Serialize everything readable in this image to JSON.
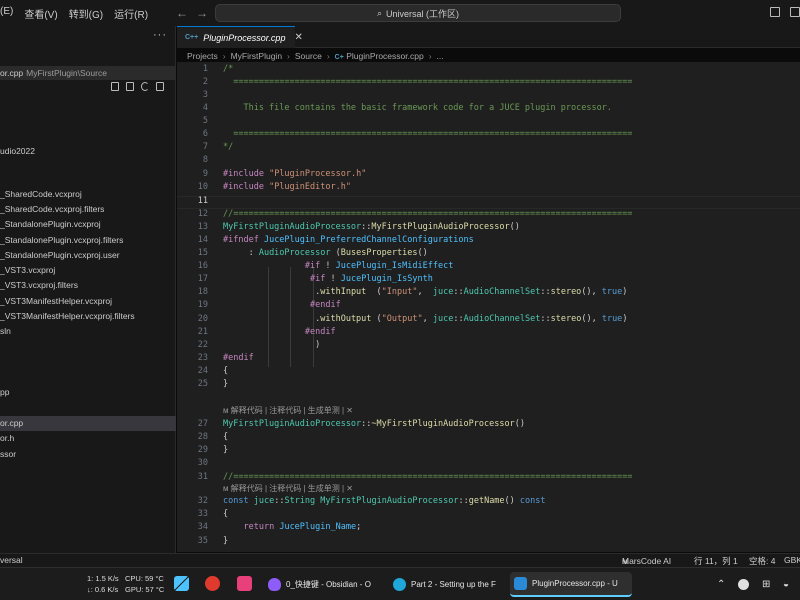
{
  "titlebar": {
    "menu": [
      "(E)",
      "查看(V)",
      "转到(G)",
      "运行(R)"
    ],
    "search": "Universal (工作区)"
  },
  "sidebar": {
    "more": "···",
    "open_file": "or.cpp",
    "open_path": "MyFirstPlugin\\Source",
    "tree": [
      {
        "label": "udio2022",
        "selected": false
      },
      {
        "label": "_SharedCode.vcxproj",
        "selected": false
      },
      {
        "label": "_SharedCode.vcxproj.filters",
        "selected": false
      },
      {
        "label": "_StandalonePlugin.vcxproj",
        "selected": false
      },
      {
        "label": "_StandalonePlugin.vcxproj.filters",
        "selected": false
      },
      {
        "label": "_StandalonePlugin.vcxproj.user",
        "selected": false
      },
      {
        "label": "_VST3.vcxproj",
        "selected": false
      },
      {
        "label": "_VST3.vcxproj.filters",
        "selected": false
      },
      {
        "label": "_VST3ManifestHelper.vcxproj",
        "selected": false
      },
      {
        "label": "_VST3ManifestHelper.vcxproj.filters",
        "selected": false
      },
      {
        "label": "sln",
        "selected": false
      },
      {
        "label": "pp",
        "selected": false
      },
      {
        "label": "or.cpp",
        "selected": true
      },
      {
        "label": "or.h",
        "selected": false
      },
      {
        "label": "ssor",
        "selected": false
      }
    ]
  },
  "tab": {
    "label": "PluginProcessor.cpp",
    "icon": "C++"
  },
  "breadcrumb": [
    "Projects",
    "MyFirstPlugin",
    "Source",
    "PluginProcessor.cpp",
    "..."
  ],
  "editor": {
    "line_numbers": [
      "1",
      "2",
      "3",
      "4",
      "5",
      "6",
      "7",
      "8",
      "9",
      "10",
      "11",
      "12",
      "13",
      "14",
      "15",
      "16",
      "17",
      "18",
      "19",
      "20",
      "21",
      "22",
      "23",
      "24",
      "25",
      "26",
      "27",
      "28",
      "29",
      "30",
      "31",
      "32",
      "33",
      "34",
      "35"
    ],
    "active_line": "11",
    "codelens": [
      "解释代码 | 注释代码 | 生成单测 | ✕",
      "解释代码 | 注释代码 | 生成单测 | ✕"
    ],
    "code": {
      "l1": "/*",
      "l2": "  ==============================================================================",
      "l4": "    This file contains the basic framework code for a JUCE plugin processor.",
      "l6": "  ==============================================================================",
      "l7": "*/",
      "inc": "#include",
      "inc1": "\"PluginProcessor.h\"",
      "inc2": "\"PluginEditor.h\"",
      "l12": "//==============================================================================",
      "cls": "MyFirstPluginAudioProcessor",
      "ctor": "MyFirstPluginAudioProcessor",
      "ifndef": "#ifndef",
      "chcfg": "JucePlugin_PreferredChannelConfigurations",
      "l15a": "     : ",
      "ap": "AudioProcessor",
      "bp": "BusesProperties",
      "if": "#if",
      "midi": "JucePlugin_IsMidiEffect",
      "synth": "JucePlugin_IsSynth",
      "withInput": "withInput",
      "sInput": "\"Input\"",
      "withOutput": "withOutput",
      "sOutput": "\"Output\"",
      "juce": "juce",
      "acs": "AudioChannelSet",
      "stereo": "stereo",
      "true": "true",
      "endif": "#endif",
      "dtor": "~MyFirstPluginAudioProcessor",
      "const": "const",
      "string": "String",
      "getName": "getName",
      "ret": "return",
      "name": "JucePlugin_Name"
    }
  },
  "status": {
    "left": "versal",
    "marscode": "MarsCode AI",
    "position": "行 11，列 1",
    "spaces": "空格: 4",
    "encoding": "GBK"
  },
  "taskbar": {
    "net_up": "1: 1.5 K/s",
    "net_down": "↓: 0.6 K/s",
    "cpu": "CPU: 59 °C",
    "gpu": "GPU: 57 °C",
    "tasks": [
      "0_快捷键 - Obsidian - O",
      "Part 2 - Setting up the F",
      "PluginProcessor.cpp - U"
    ]
  }
}
